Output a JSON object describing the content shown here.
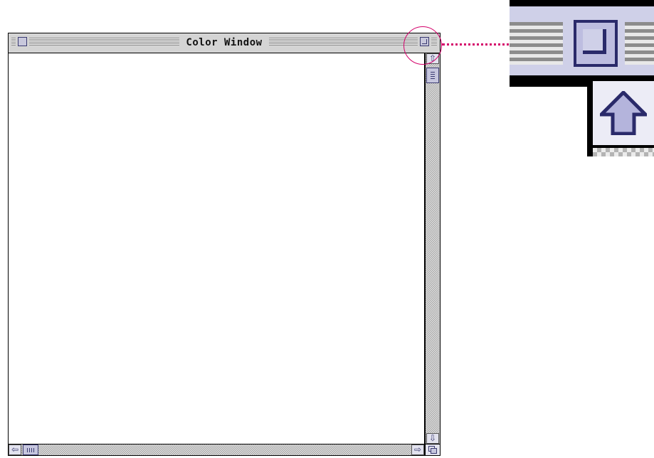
{
  "window": {
    "title": "Color Window"
  },
  "icons": {
    "close_box": "close-box-icon",
    "zoom_box": "zoom-box-icon",
    "scroll_up": "arrow-up-icon",
    "scroll_down": "arrow-down-icon",
    "scroll_left": "arrow-left-icon",
    "scroll_right": "arrow-right-icon",
    "grow_box": "size-box-icon"
  },
  "colors": {
    "accent": "#3a3a70",
    "control_fill": "#c6c6de",
    "callout": "#d4006a"
  }
}
